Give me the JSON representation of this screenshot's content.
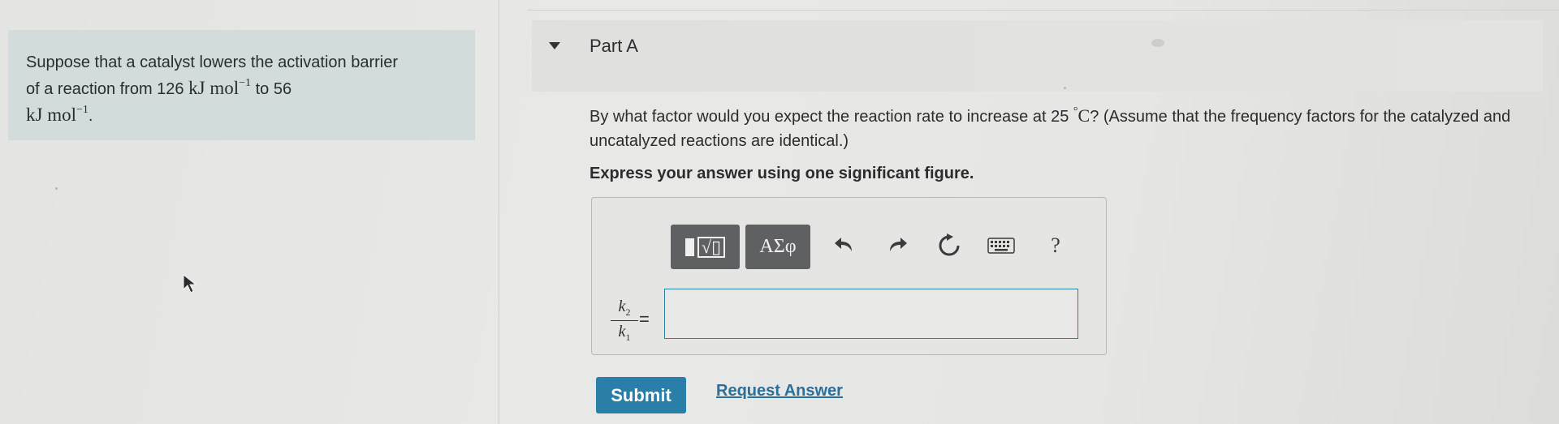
{
  "problem": {
    "line1": "Suppose that a catalyst lowers the activation barrier",
    "line2_prefix": "of a reaction from 126",
    "unit_main": "kJ mol",
    "unit_exp": "−1",
    "line2_mid": "to 56",
    "line3_suffix": "."
  },
  "part": {
    "title": "Part A"
  },
  "question": {
    "text_before": "By what factor would you expect the reaction rate to increase at 25",
    "temp_unit_sup": "°",
    "temp_unit": "C",
    "text_after": "? (Assume that the frequency factors for the catalyzed and uncatalyzed reactions are identical.)",
    "instruction": "Express your answer using one significant figure."
  },
  "toolbar": {
    "template_symbol": "√▯",
    "greek_label": "ΑΣφ",
    "help_label": "?"
  },
  "answer": {
    "lhs_num_var": "k",
    "lhs_num_sub": "2",
    "lhs_den_var": "k",
    "lhs_den_sub": "1",
    "equals": "=",
    "value": ""
  },
  "actions": {
    "submit_label": "Submit",
    "request_label": "Request Answer"
  },
  "colors": {
    "accent": "#2a7fa8",
    "problem_bg": "#d2dcdb",
    "toolbar_btn": "#5f6061"
  }
}
